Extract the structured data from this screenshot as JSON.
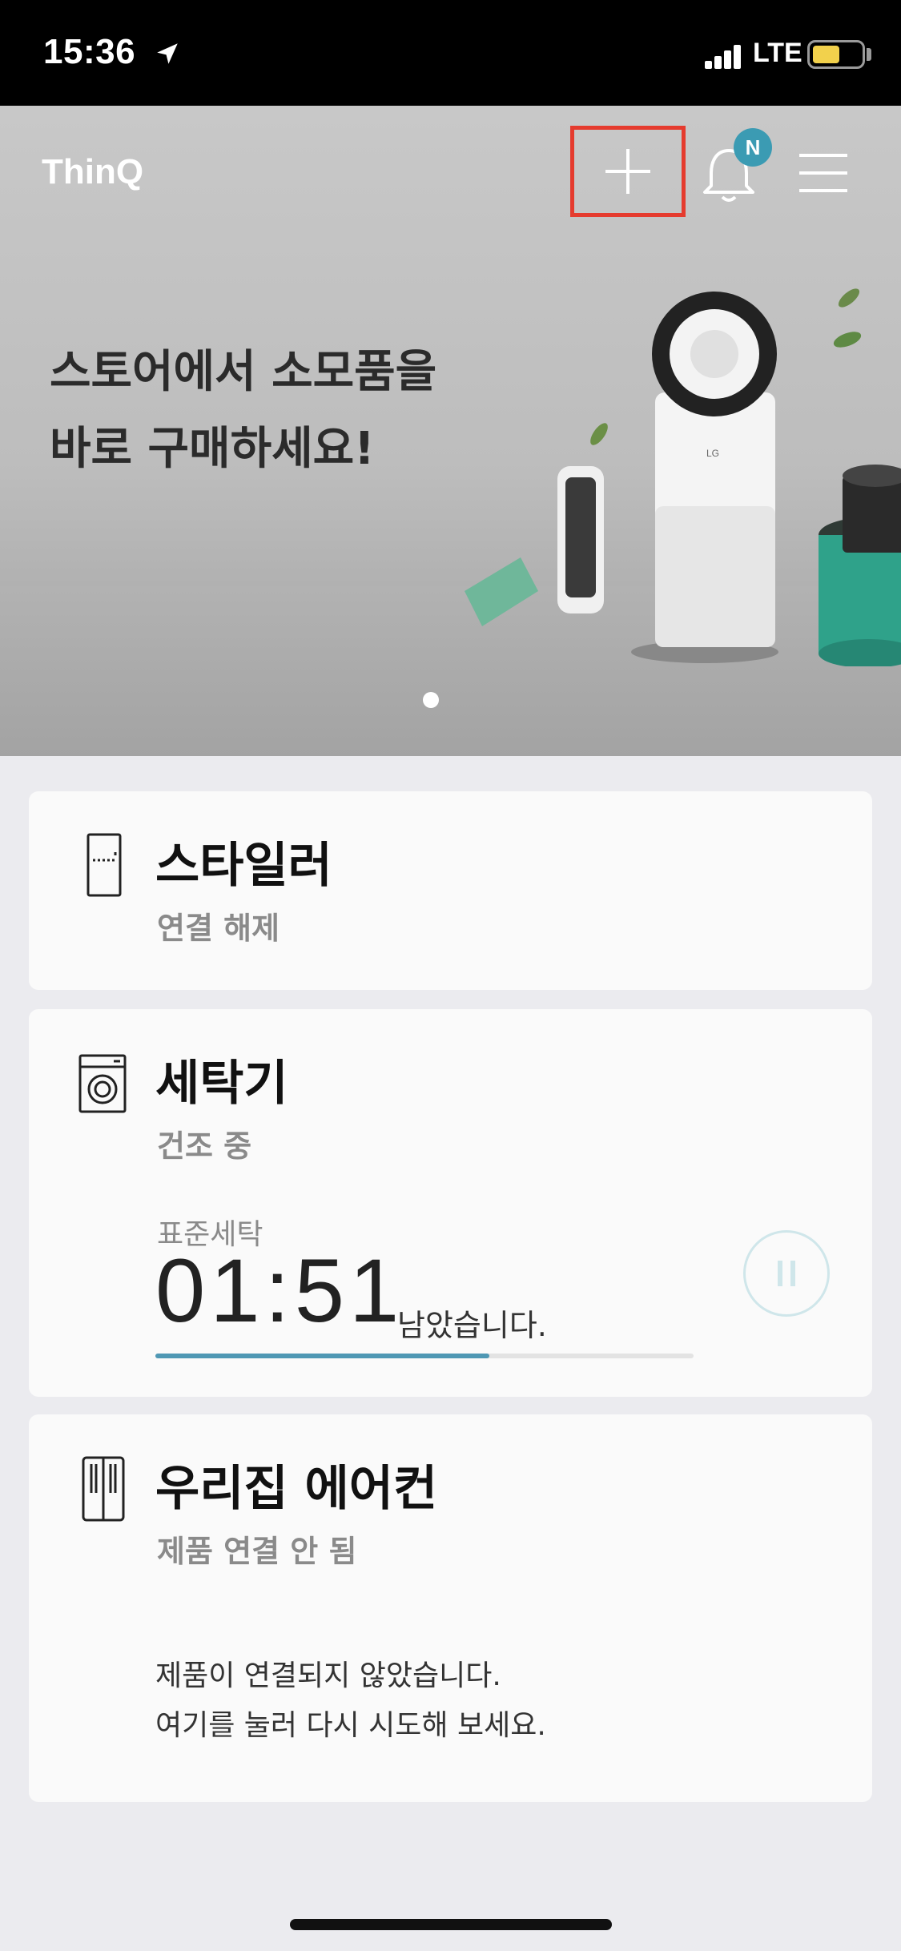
{
  "status_bar": {
    "time": "15:36",
    "network": "LTE",
    "battery_level": 0.56
  },
  "header": {
    "logo": "ThinQ",
    "notification_badge": "N",
    "icons": [
      "add-icon",
      "bell-icon",
      "hamburger-menu-icon"
    ],
    "highlight_color": "#e53b2e"
  },
  "banner": {
    "headline_line1": "스토어에서 소모품을",
    "headline_line2": "바로 구매하세요!",
    "slide_count": 2,
    "active_slide": 1
  },
  "devices": [
    {
      "name": "스타일러",
      "status": "연결 해제",
      "icon": "styler-icon"
    },
    {
      "name": "세탁기",
      "status": "건조 중",
      "icon": "washer-icon",
      "course": "표준세탁",
      "time_remaining": "01:51",
      "time_suffix": "남았습니다.",
      "progress": 0.62,
      "control_icon": "pause-icon"
    },
    {
      "name": "우리집 에어컨",
      "status": "제품 연결 안 됨",
      "icon": "air-conditioner-icon",
      "note_line1": "제품이 연결되지 않았습니다.",
      "note_line2": "여기를 눌러 다시 시도해 보세요."
    }
  ],
  "colors": {
    "accent": "#4f98b4",
    "badge": "#3b9bb3",
    "background": "#ebebef"
  }
}
